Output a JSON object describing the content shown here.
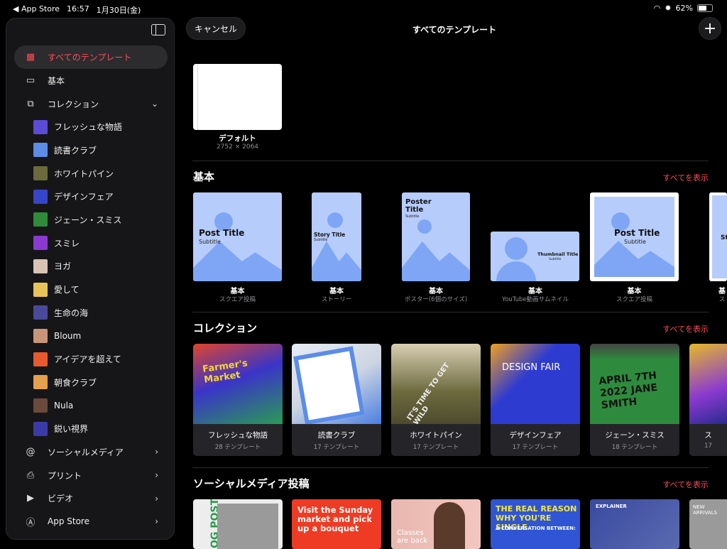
{
  "status_bar": {
    "back_label": "◀ App Store",
    "time": "16:57",
    "date": "1月30日(金)",
    "battery": "62%",
    "battery_level": 0.62
  },
  "header": {
    "cancel_label": "キャンセル",
    "title": "すべてのテンプレート"
  },
  "sidebar": {
    "items": [
      {
        "label": "すべてのテンプレート",
        "icon": "grid-icon"
      },
      {
        "label": "基本",
        "icon": "basic-icon"
      },
      {
        "label": "コレクション",
        "icon": "collection-icon"
      }
    ],
    "collections": [
      {
        "label": "フレッシュな物語",
        "color": "#5b4bd6"
      },
      {
        "label": "読書クラブ",
        "color": "#5b8ce8"
      },
      {
        "label": "ホワイトパイン",
        "color": "#6b6a3a"
      },
      {
        "label": "デザインフェア",
        "color": "#3646c9"
      },
      {
        "label": "ジェーン・スミス",
        "color": "#2f8a3a"
      },
      {
        "label": "スミレ",
        "color": "#8a3ad0"
      },
      {
        "label": "ヨガ",
        "color": "#d9c3b5"
      },
      {
        "label": "愛して",
        "color": "#e7c45a"
      },
      {
        "label": "生命の海",
        "color": "#4b4a9a"
      },
      {
        "label": "Bloum",
        "color": "#c9957a"
      },
      {
        "label": "アイデアを超えて",
        "color": "#e65a2e"
      },
      {
        "label": "朝食クラブ",
        "color": "#e4a04a"
      },
      {
        "label": "Nula",
        "color": "#6a4a3a"
      },
      {
        "label": "鋭い視界",
        "color": "#3a3aa8"
      }
    ],
    "more": [
      {
        "label": "ソーシャルメディア",
        "icon": "at-icon"
      },
      {
        "label": "プリント",
        "icon": "printer-icon"
      },
      {
        "label": "ビデオ",
        "icon": "video-icon"
      },
      {
        "label": "App Store",
        "icon": "app-store-icon"
      }
    ]
  },
  "default_template": {
    "label": "デフォルト",
    "size": "2752 × 2064"
  },
  "sections": {
    "basic": {
      "title": "基本",
      "more": "すべてを表示"
    },
    "collection": {
      "title": "コレクション",
      "more": "すべてを表示"
    },
    "social": {
      "title": "ソーシャルメディア投稿",
      "more": "すべてを表示"
    }
  },
  "basic_templates": [
    {
      "name": "基本",
      "kind": "スクエア投稿",
      "title": "Post Title",
      "subtitle": "Subtitle"
    },
    {
      "name": "基本",
      "kind": "ストーリー",
      "title": "Story Title",
      "subtitle": "Subtitle"
    },
    {
      "name": "基本",
      "kind": "ポスター(6個のサイズ)",
      "title": "Poster Title",
      "subtitle": "Subtitle"
    },
    {
      "name": "基本",
      "kind": "YouTube動画サムネイル",
      "title": "Thumbnail Title",
      "subtitle": "Subtitle"
    },
    {
      "name": "基本",
      "kind": "スクエア投稿",
      "title": "Post Title",
      "subtitle": "Subtitle"
    },
    {
      "name": "基",
      "kind": "ス",
      "title": "St"
    }
  ],
  "collection_cards": [
    {
      "name": "フレッシュな物語",
      "count": "28 テンプレート",
      "art": "Farmer's Market",
      "color": "#3a34c8"
    },
    {
      "name": "読書クラブ",
      "count": "17 テンプレート",
      "art": "",
      "color": "#dfe3ea"
    },
    {
      "name": "ホワイトパイン",
      "count": "17 テンプレート",
      "art": "IT'S TIME TO GET WILD",
      "color": "#6d6a3f"
    },
    {
      "name": "デザインフェア",
      "count": "17 テンプレート",
      "art": "DESIGN FAIR",
      "color": "#2d3bd1"
    },
    {
      "name": "ジェーン・スミス",
      "count": "18 テンプレート",
      "art": "APRIL 7TH 2022 JANE SMITH",
      "color": "#2e8b3d"
    },
    {
      "name": "ス",
      "count": "17",
      "art": "",
      "color": "#e5b82a"
    }
  ],
  "social_cards": [
    {
      "text": "OG POST",
      "color": "#f0f0f0"
    },
    {
      "text": "Visit the Sunday market and pick up a bouquet",
      "color": "#ee3b24"
    },
    {
      "text": "Classes are back",
      "color": "#e8b8b0"
    },
    {
      "text": "THE REAL REASON WHY YOU'RE SINGLE",
      "color": "#2f55d4",
      "subtext": "A CONVERSATION BETWEEN:"
    },
    {
      "text": "EXPLAINER",
      "color": "#3a4aa0"
    },
    {
      "text": "NEW ARRIVALS",
      "color": "#9a9a9a"
    }
  ]
}
